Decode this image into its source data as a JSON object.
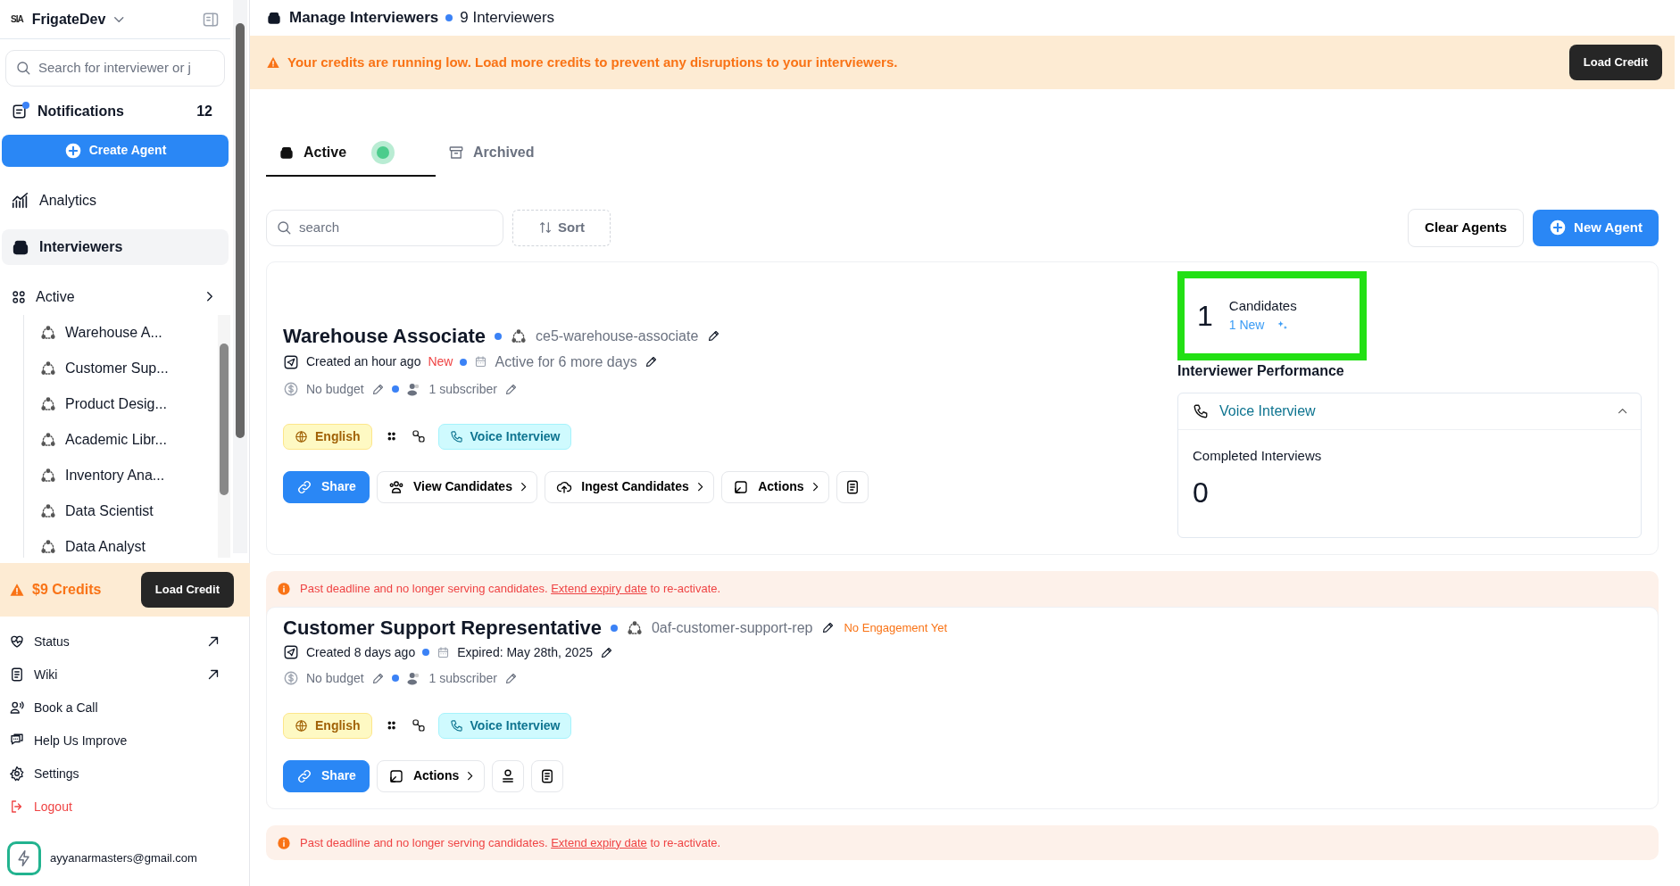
{
  "sidebar": {
    "logo": "SIA",
    "workspace": "FrigateDev",
    "search": {
      "placeholder": "Search for interviewer or j"
    },
    "notifications": {
      "label": "Notifications",
      "count": "12",
      "unread": true
    },
    "create_button": "Create Agent",
    "nav": [
      {
        "label": "Analytics",
        "kind": "analytics",
        "selected": false
      },
      {
        "label": "Interviewers",
        "kind": "interviewers",
        "selected": true
      }
    ],
    "group": {
      "label": "Active",
      "children": [
        {
          "label": "Warehouse A..."
        },
        {
          "label": "Customer Sup..."
        },
        {
          "label": "Product Desig..."
        },
        {
          "label": "Academic Libr..."
        },
        {
          "label": "Inventory Ana..."
        },
        {
          "label": "Data Scientist"
        },
        {
          "label": "Data Analyst"
        }
      ]
    },
    "credits": {
      "label": "$9 Credits",
      "button": "Load Credit"
    },
    "links": [
      {
        "label": "Status",
        "kind": "status",
        "external": true
      },
      {
        "label": "Wiki",
        "kind": "wiki",
        "external": true
      },
      {
        "label": "Book a Call",
        "kind": "call",
        "external": false
      },
      {
        "label": "Help Us Improve",
        "kind": "help",
        "external": false
      },
      {
        "label": "Settings",
        "kind": "settings",
        "external": false
      },
      {
        "label": "Logout",
        "kind": "logout",
        "external": false
      }
    ],
    "user": {
      "email": "ayyanarmasters@gmail.com"
    }
  },
  "header": {
    "title": "Manage Interviewers",
    "count": "9 Interviewers"
  },
  "banner": {
    "text": "Your credits are running low. Load more credits to prevent any disruptions to your interviewers.",
    "button": "Load Credit"
  },
  "tabs": [
    {
      "label": "Active",
      "kind": "active",
      "selected": true,
      "live": true
    },
    {
      "label": "Archived",
      "kind": "archived",
      "selected": false,
      "live": false
    }
  ],
  "toolbar": {
    "search": {
      "placeholder": "search"
    },
    "sort": "Sort",
    "clear": "Clear Agents",
    "new": "New Agent"
  },
  "agents": [
    {
      "title": "Warehouse Associate",
      "slug": "ce5-warehouse-associate",
      "created": "Created an hour ago",
      "new_badge": "New",
      "schedule": "Active for 6 more days",
      "budget": "No budget",
      "subscribers": "1 subscriber",
      "language": "English",
      "mode": "Voice Interview",
      "buttons": [
        {
          "kind": "share",
          "label": "Share"
        },
        {
          "kind": "view",
          "label": "View Candidates"
        },
        {
          "kind": "ingest",
          "label": "Ingest Candidates"
        },
        {
          "kind": "actions",
          "label": "Actions"
        },
        {
          "kind": "notes"
        }
      ],
      "stats": {
        "count": "1",
        "label": "Candidates",
        "new": "1 New",
        "highlighted": true,
        "performance_title": "Interviewer Performance",
        "section": {
          "label": "Voice Interview",
          "expanded": true,
          "metric_label": "Completed Interviews",
          "metric_value": "0"
        }
      }
    },
    {
      "alert": {
        "before": "Past deadline and no longer serving candidates.",
        "link": "Extend expiry date",
        "after": "to re-activate."
      },
      "title": "Customer Support Representative",
      "slug": "0af-customer-support-rep",
      "engagement": "No Engagement Yet",
      "created": "Created 8 days ago",
      "schedule": "Expired: May 28th, 2025",
      "budget": "No budget",
      "subscribers": "1 subscriber",
      "language": "English",
      "mode": "Voice Interview",
      "buttons": [
        {
          "kind": "share",
          "label": "Share"
        },
        {
          "kind": "actions",
          "label": "Actions"
        },
        {
          "kind": "person"
        },
        {
          "kind": "notes"
        }
      ]
    },
    {
      "alert": {
        "before": "Past deadline and no longer serving candidates.",
        "link": "Extend expiry date",
        "after": "to re-activate."
      }
    }
  ]
}
